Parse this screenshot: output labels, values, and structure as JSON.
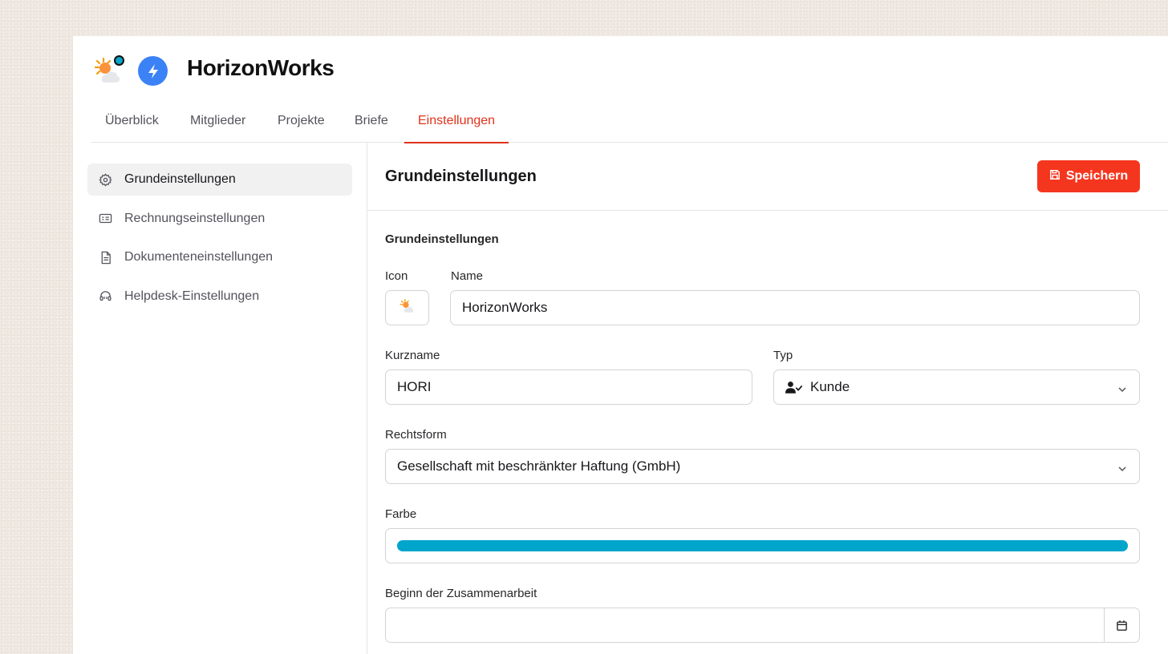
{
  "app": {
    "title": "HorizonWorks",
    "brand_emoji": "sun-behind-cloud-icon",
    "status_dot_color": "#0aa4c8",
    "bolt_badge_color": "#3b82f6"
  },
  "tabs": [
    {
      "label": "Überblick",
      "active": false
    },
    {
      "label": "Mitglieder",
      "active": false
    },
    {
      "label": "Projekte",
      "active": false
    },
    {
      "label": "Briefe",
      "active": false
    },
    {
      "label": "Einstellungen",
      "active": true
    }
  ],
  "sidebar": {
    "items": [
      {
        "label": "Grundeinstellungen",
        "icon": "gear-icon",
        "active": true
      },
      {
        "label": "Rechnungseinstellungen",
        "icon": "invoice-icon",
        "active": false
      },
      {
        "label": "Dokumenteneinstellungen",
        "icon": "document-icon",
        "active": false
      },
      {
        "label": "Helpdesk-Einstellungen",
        "icon": "headset-icon",
        "active": false
      }
    ]
  },
  "main": {
    "title": "Grundeinstellungen",
    "save_label": "Speichern",
    "section_title": "Grundeinstellungen",
    "form": {
      "icon_label": "Icon",
      "icon_value": "sun-behind-cloud-icon",
      "name_label": "Name",
      "name_value": "HorizonWorks",
      "kurzname_label": "Kurzname",
      "kurzname_value": "HORI",
      "typ_label": "Typ",
      "typ_value": "Kunde",
      "rechtsform_label": "Rechtsform",
      "rechtsform_value": "Gesellschaft mit beschränkter Haftung (GmbH)",
      "farbe_label": "Farbe",
      "farbe_value": "#00a5cb",
      "beginn_label": "Beginn der Zusammenarbeit",
      "beginn_value": ""
    }
  },
  "colors": {
    "accent": "#e0321b",
    "save_button": "#f5361f"
  }
}
